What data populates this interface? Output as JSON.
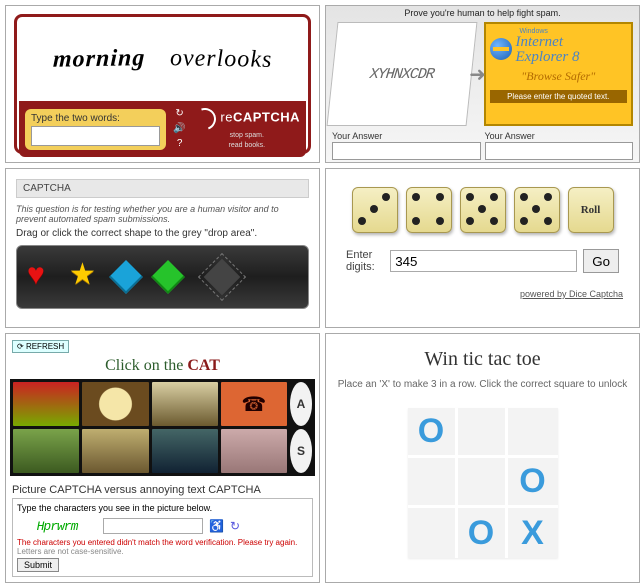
{
  "recaptcha": {
    "word1": "morning",
    "word2": "overlooks",
    "prompt": "Type the two words:",
    "brand_prefix": "re",
    "brand_main": "CAPTCHA",
    "tag1": "stop spam.",
    "tag2": "read books.",
    "refresh_icon": "↻",
    "audio_icon": "🔊",
    "help_icon": "?"
  },
  "ie": {
    "header": "Prove you're human to help fight spam.",
    "captcha_text": "XYHNXCDR",
    "ad": {
      "windows": "Windows",
      "line1": "Internet",
      "line2": "Explorer 8",
      "slogan": "\"Browse Safer\"",
      "instruction": "Please enter the quoted text."
    },
    "left_label": "Your Answer",
    "right_label": "Your Answer"
  },
  "shape": {
    "title": "CAPTCHA",
    "question": "This question is for testing whether you are a human visitor and to prevent automated spam submissions.",
    "instruction": "Drag or click the correct shape to the grey \"drop area\"."
  },
  "dice": {
    "faces": [
      3,
      4,
      5,
      5
    ],
    "roll_label": "Roll",
    "input_label": "Enter digits:",
    "input_value": "345",
    "go_label": "Go",
    "footer": "powered by Dice Captcha"
  },
  "picture": {
    "refresh": "REFRESH",
    "title_pre": "Click on the ",
    "title_word": "CAT",
    "letters": [
      "A",
      "S"
    ],
    "subtitle": "Picture CAPTCHA versus annoying text CAPTCHA",
    "box_title": "Type the characters you see in the picture below.",
    "fake_text": "Hprwrm",
    "error": "The characters you entered didn't match the word verification. Please try again.",
    "note": "Letters are not case-sensitive.",
    "submit": "Submit"
  },
  "ttt": {
    "title": "Win tic tac toe",
    "subtitle": "Place an 'X' to make 3 in a row. Click the correct square to unlock",
    "board": [
      "O",
      "",
      "",
      "",
      "",
      "O",
      "",
      "O",
      "X"
    ]
  }
}
